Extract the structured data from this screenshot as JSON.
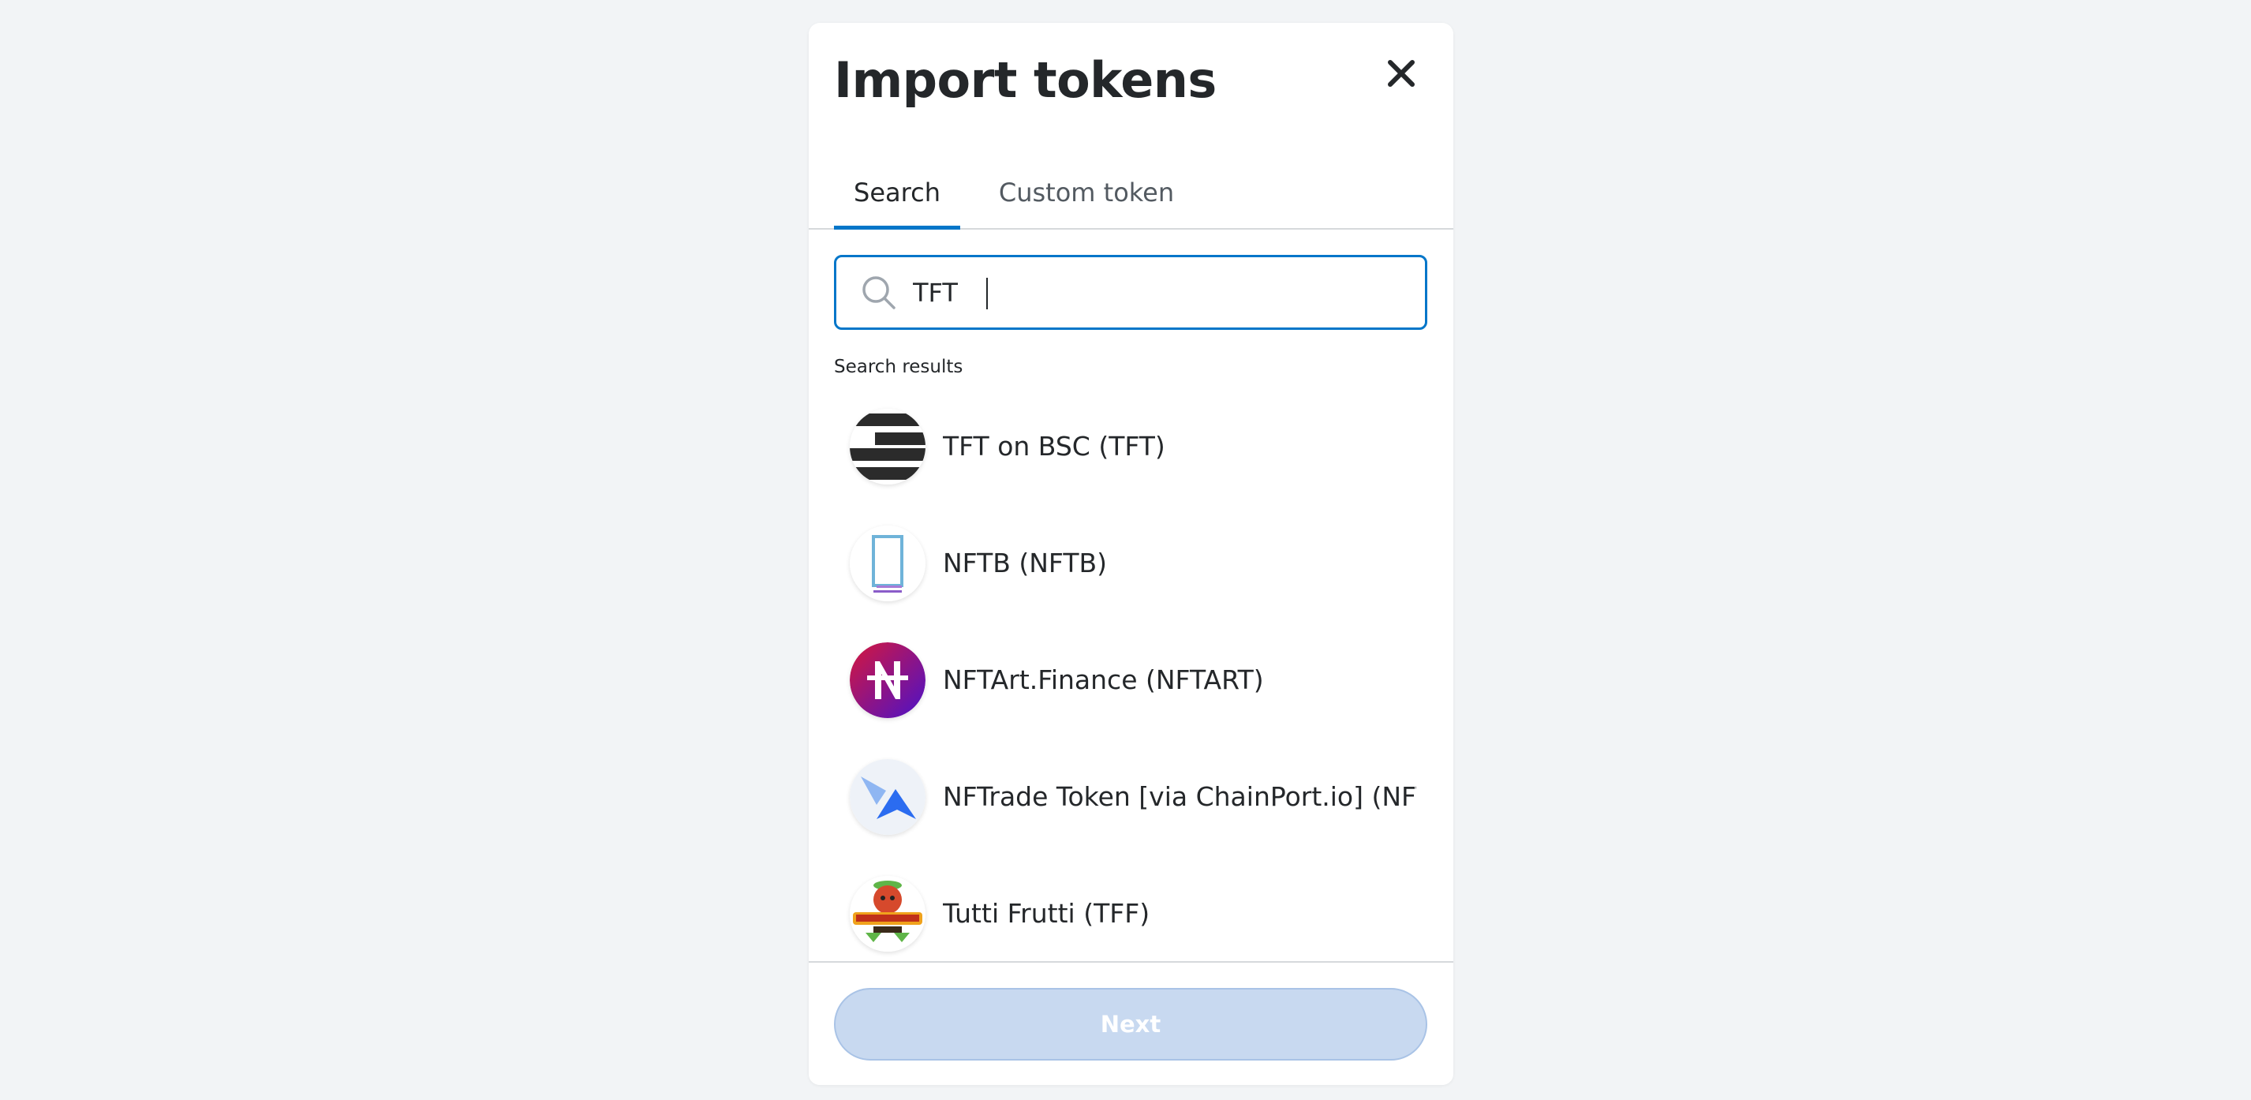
{
  "modal": {
    "title": "Import tokens",
    "close_icon": "close-icon"
  },
  "tabs": [
    {
      "label": "Search",
      "active": true
    },
    {
      "label": "Custom token",
      "active": false
    }
  ],
  "search": {
    "value": "TFT",
    "placeholder": "",
    "icon": "search-icon"
  },
  "results": {
    "label": "Search results",
    "items": [
      {
        "label": "TFT on BSC (TFT)",
        "icon": "tft-logo-icon"
      },
      {
        "label": "NFTB (NFTB)",
        "icon": "nftb-logo-icon"
      },
      {
        "label": "NFTArt.Finance (NFTART)",
        "icon": "nftart-logo-icon"
      },
      {
        "label": "NFTrade Token [via ChainPort.io] (NFT...",
        "icon": "nftrade-logo-icon"
      },
      {
        "label": "Tutti Frutti (TFF)",
        "icon": "tutti-frutti-logo-icon"
      }
    ]
  },
  "footer": {
    "next_label": "Next",
    "next_disabled": true
  },
  "colors": {
    "accent": "#0376c9",
    "disabled_button": "#c8d9f0",
    "background": "#f2f4f6"
  }
}
